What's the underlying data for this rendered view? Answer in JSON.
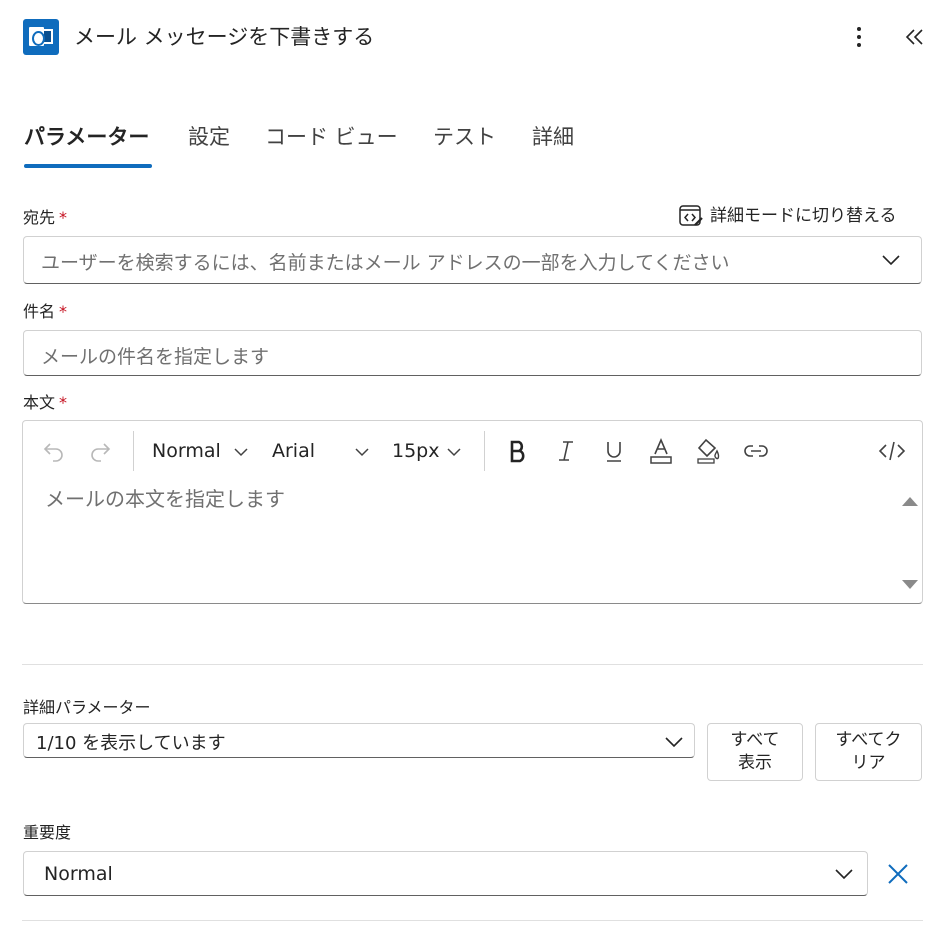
{
  "header": {
    "title": "メール メッセージを下書きする",
    "app_icon": "outlook-icon",
    "more_icon": "more-vertical-icon",
    "collapse_icon": "double-chevron-left-icon"
  },
  "tabs": [
    {
      "label": "パラメーター",
      "active": true
    },
    {
      "label": "設定",
      "active": false
    },
    {
      "label": "コード ビュー",
      "active": false
    },
    {
      "label": "テスト",
      "active": false
    },
    {
      "label": "詳細",
      "active": false
    }
  ],
  "fields": {
    "to": {
      "label": "宛先",
      "required_mark": "*",
      "placeholder": "ユーザーを検索するには、名前またはメール アドレスの一部を入力してください"
    },
    "advanced_mode": {
      "label": "詳細モードに切り替える",
      "icon": "code-edit-icon"
    },
    "subject": {
      "label": "件名",
      "required_mark": "*",
      "placeholder": "メールの件名を指定します"
    },
    "body": {
      "label": "本文",
      "required_mark": "*",
      "placeholder": "メールの本文を指定します",
      "toolbar": {
        "style": "Normal",
        "font": "Arial",
        "size": "15px",
        "icons": [
          "undo-icon",
          "redo-icon",
          "bold-icon",
          "italic-icon",
          "underline-icon",
          "font-color-icon",
          "fill-color-icon",
          "link-icon",
          "code-view-icon"
        ]
      }
    }
  },
  "advanced_params": {
    "label": "詳細パラメーター",
    "select_value": "1/10 を表示しています",
    "show_all": "すべて\n表示",
    "clear_all": "すべてク\nリア"
  },
  "importance": {
    "label": "重要度",
    "value": "Normal",
    "clear_icon": "close-icon"
  },
  "colors": {
    "accent": "#0f6cbd",
    "required": "#c50f1f"
  }
}
